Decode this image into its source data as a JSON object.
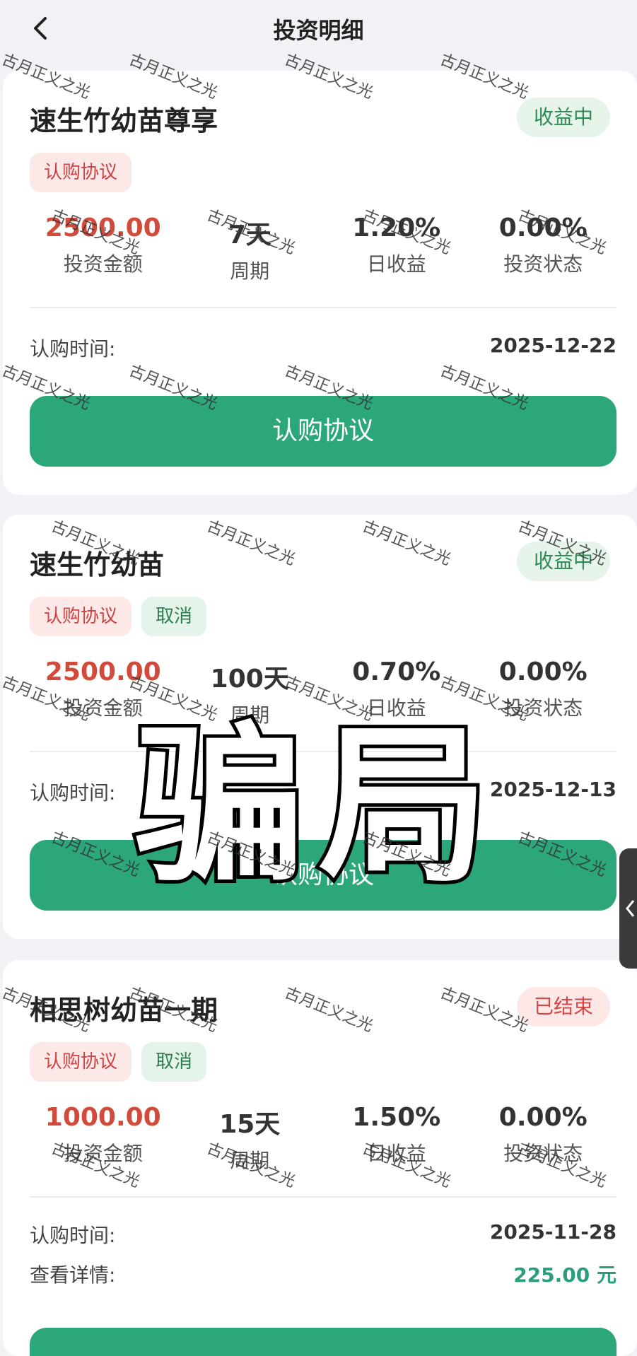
{
  "header": {
    "title": "投资明细"
  },
  "cards": [
    {
      "name": "速生竹幼苗尊享",
      "status": "收益中",
      "tags": [
        "认购协议"
      ],
      "stats": [
        {
          "value": "2500.00",
          "label": "投资金额"
        },
        {
          "value": "7天",
          "label": "周期"
        },
        {
          "value": "1.20%",
          "label": "日收益"
        },
        {
          "value": "0.00%",
          "label": "投资状态"
        }
      ],
      "rows": [
        {
          "key": "认购时间:",
          "value": "2025-12-22"
        }
      ],
      "button": "认购协议"
    },
    {
      "name": "速生竹幼苗",
      "status": "收益中",
      "tags": [
        "认购协议",
        "取消"
      ],
      "stats": [
        {
          "value": "2500.00",
          "label": "投资金额"
        },
        {
          "value": "100天",
          "label": "周期"
        },
        {
          "value": "0.70%",
          "label": "日收益"
        },
        {
          "value": "0.00%",
          "label": "投资状态"
        }
      ],
      "rows": [
        {
          "key": "认购时间:",
          "value": "2025-12-13"
        }
      ],
      "button": "认购协议"
    },
    {
      "name": "相思树幼苗一期",
      "status": "已结束",
      "tags": [
        "认购协议",
        "取消"
      ],
      "stats": [
        {
          "value": "1000.00",
          "label": "投资金额"
        },
        {
          "value": "15天",
          "label": "周期"
        },
        {
          "value": "1.50%",
          "label": "日收益"
        },
        {
          "value": "0.00%",
          "label": "投资状态"
        }
      ],
      "rows": [
        {
          "key": "认购时间:",
          "value": "2025-11-28"
        },
        {
          "key": "查看详情:",
          "value": "225.00 元"
        }
      ]
    }
  ],
  "overlay_text": "骗局",
  "watermark_text": "古月正义之光",
  "colors": {
    "accent": "#2ca77a",
    "amount_red": "#d24a3a",
    "status_green": "#2e8b57",
    "status_red": "#d64545"
  }
}
